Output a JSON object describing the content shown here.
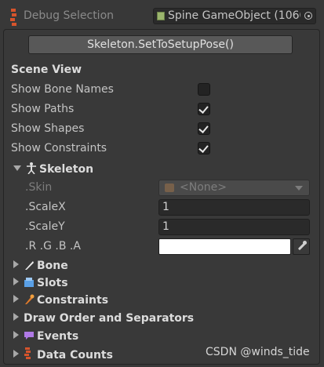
{
  "header": {
    "title": "Debug Selection",
    "object_field": "Spine GameObject (1060"
  },
  "buttons": {
    "setup_pose": "Skeleton.SetToSetupPose()"
  },
  "scene_view": {
    "title": "Scene View",
    "rows": [
      {
        "label": "Show Bone Names",
        "checked": false
      },
      {
        "label": "Show Paths",
        "checked": true
      },
      {
        "label": "Show Shapes",
        "checked": true
      },
      {
        "label": "Show Constraints",
        "checked": true
      }
    ]
  },
  "skeleton": {
    "title": "Skeleton",
    "skin_label": ".Skin",
    "skin_value": "<None>",
    "scalex_label": ".ScaleX",
    "scalex_value": "1",
    "scaley_label": ".ScaleY",
    "scaley_value": "1",
    "rgba_label": ".R .G .B .A",
    "color": "#ffffff"
  },
  "foldouts": {
    "bone": "Bone",
    "slots": "Slots",
    "constraints": "Constraints",
    "draw_order": "Draw Order and Separators",
    "events": "Events",
    "data_counts": "Data Counts"
  },
  "watermark": "CSDN @winds_tide",
  "icons": {
    "header": "spine-debug-icon",
    "skeleton": "skeleton-figure-icon",
    "bone": "bone-icon",
    "slots": "slots-icon",
    "constraints": "constraints-icon",
    "events": "event-flag-icon",
    "data_counts": "spine-icon"
  }
}
